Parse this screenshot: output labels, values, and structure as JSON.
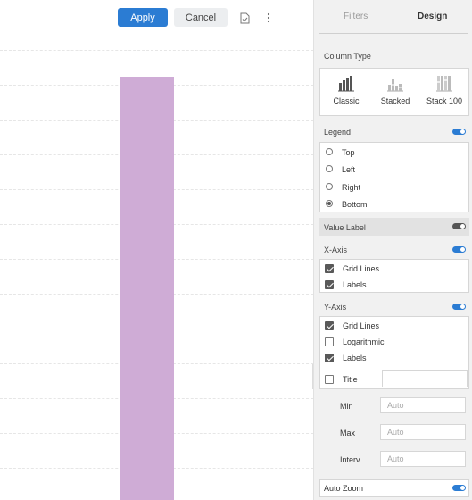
{
  "toolbar": {
    "apply_label": "Apply",
    "cancel_label": "Cancel",
    "save_icon": "document-check-icon",
    "more_icon": "more-vertical-icon"
  },
  "chart_data": {
    "type": "bar",
    "visible_categories": 1,
    "bar_color": "#cfacd6",
    "grid": true
  },
  "panel": {
    "tabs": {
      "filters": "Filters",
      "design": "Design"
    },
    "column_type": {
      "label": "Column Type",
      "options": [
        {
          "label": "Classic",
          "icon": "bar-chart-classic-icon"
        },
        {
          "label": "Stacked",
          "icon": "bar-chart-stacked-icon"
        },
        {
          "label": "Stack 100",
          "icon": "bar-chart-stack100-icon"
        }
      ]
    },
    "legend": {
      "label": "Legend",
      "enabled": true,
      "options": [
        "Top",
        "Left",
        "Right",
        "Bottom"
      ],
      "selected": "Bottom"
    },
    "value_label": {
      "label": "Value Label",
      "enabled": false
    },
    "x_axis": {
      "label": "X-Axis",
      "enabled": true,
      "grid_lines": "Grid Lines",
      "labels": "Labels"
    },
    "y_axis": {
      "label": "Y-Axis",
      "enabled": true,
      "grid_lines": "Grid Lines",
      "logarithmic": "Logarithmic",
      "labels": "Labels",
      "title": "Title",
      "title_value": "",
      "min_label": "Min",
      "min_placeholder": "Auto",
      "max_label": "Max",
      "max_placeholder": "Auto",
      "interval_label": "Interv...",
      "interval_placeholder": "Auto"
    },
    "auto_zoom": {
      "label": "Auto Zoom",
      "enabled": true
    }
  },
  "colors": {
    "accent": "#2b7cd3",
    "bar": "#cfacd6",
    "panel_bg": "#f1f1f1"
  }
}
